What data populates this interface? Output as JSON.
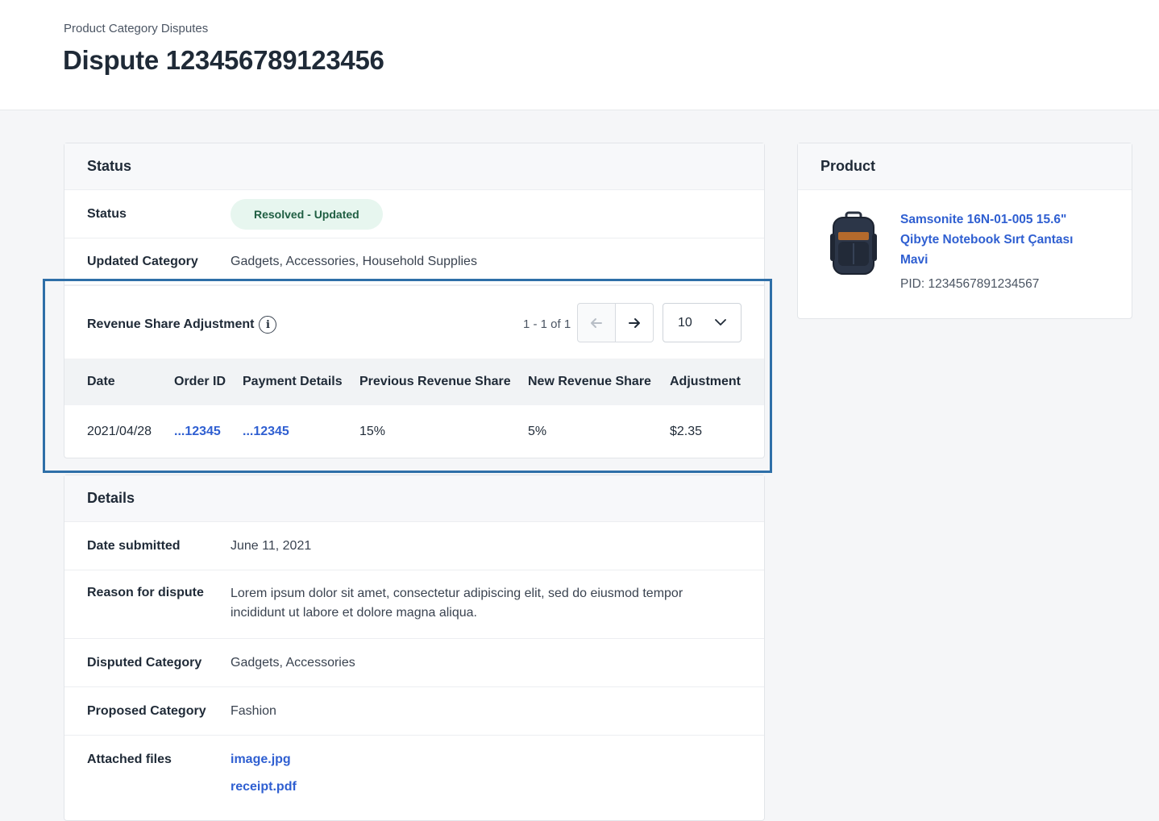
{
  "header": {
    "breadcrumb": "Product Category Disputes",
    "title": "Dispute 123456789123456"
  },
  "status_card": {
    "title": "Status",
    "status_label": "Status",
    "status_badge": "Resolved - Updated",
    "updated_category_label": "Updated Category",
    "updated_category_value": "Gadgets, Accessories, Household Supplies"
  },
  "revenue_share": {
    "title": "Revenue Share Adjustment",
    "info_icon": "info-icon",
    "pager_text": "1 - 1 of 1",
    "page_size": "10",
    "columns": [
      "Date",
      "Order ID",
      "Payment Details",
      "Previous Revenue Share",
      "New Revenue Share",
      "Adjustment"
    ],
    "rows": [
      {
        "date": "2021/04/28",
        "order_id": "...12345",
        "payment": "...12345",
        "prev_share": "15%",
        "new_share": "5%",
        "adjustment": "$2.35"
      }
    ]
  },
  "details_card": {
    "title": "Details",
    "date_label": "Date submitted",
    "date_value": "June 11, 2021",
    "reason_label": "Reason for dispute",
    "reason_value": "Lorem ipsum dolor sit amet, consectetur adipiscing elit, sed do eiusmod tempor incididunt ut labore et dolore magna aliqua.",
    "disputed_label": "Disputed Category",
    "disputed_value": "Gadgets, Accessories",
    "proposed_label": "Proposed Category",
    "proposed_value": "Fashion",
    "files_label": "Attached files",
    "files": [
      "image.jpg",
      "receipt.pdf"
    ]
  },
  "product_card": {
    "title": "Product",
    "name": "Samsonite 16N-01-005 15.6\" Qibyte Notebook Sırt Çantası Mavi",
    "pid": "PID: 1234567891234567"
  },
  "colors": {
    "link": "#2f5fd1",
    "badge_bg": "#e7f6ef",
    "highlight": "#2e6fa8"
  }
}
